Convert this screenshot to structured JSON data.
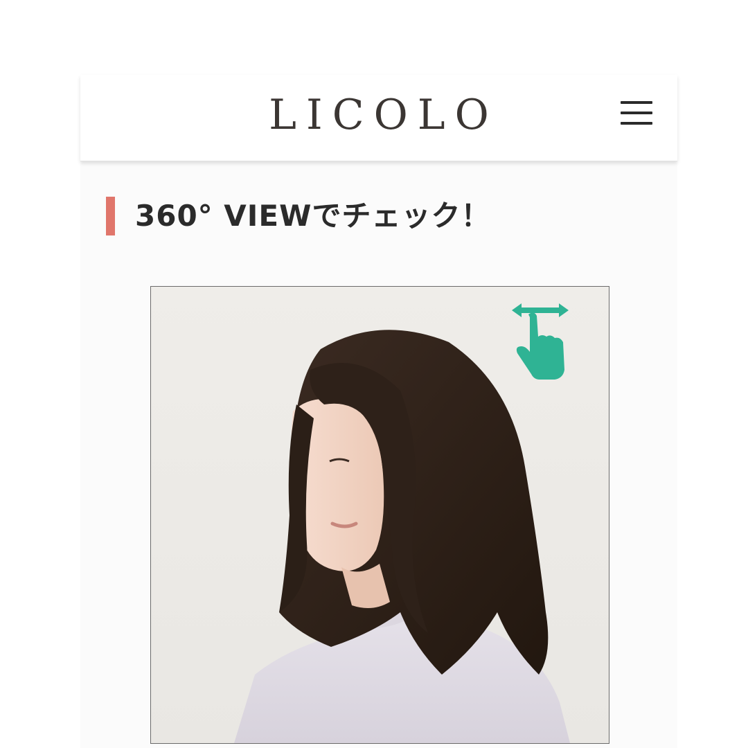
{
  "header": {
    "logo": "LICOLO",
    "menu_icon": "hamburger-menu-icon"
  },
  "section": {
    "title": "360°  VIEWでチェック！",
    "accent_color": "#e0766b"
  },
  "viewer": {
    "photo": "woman-medium-length-hairstyle-side-profile",
    "swipe_icon": "swipe-left-right-hand-icon",
    "swipe_icon_color": "#2fb394"
  }
}
